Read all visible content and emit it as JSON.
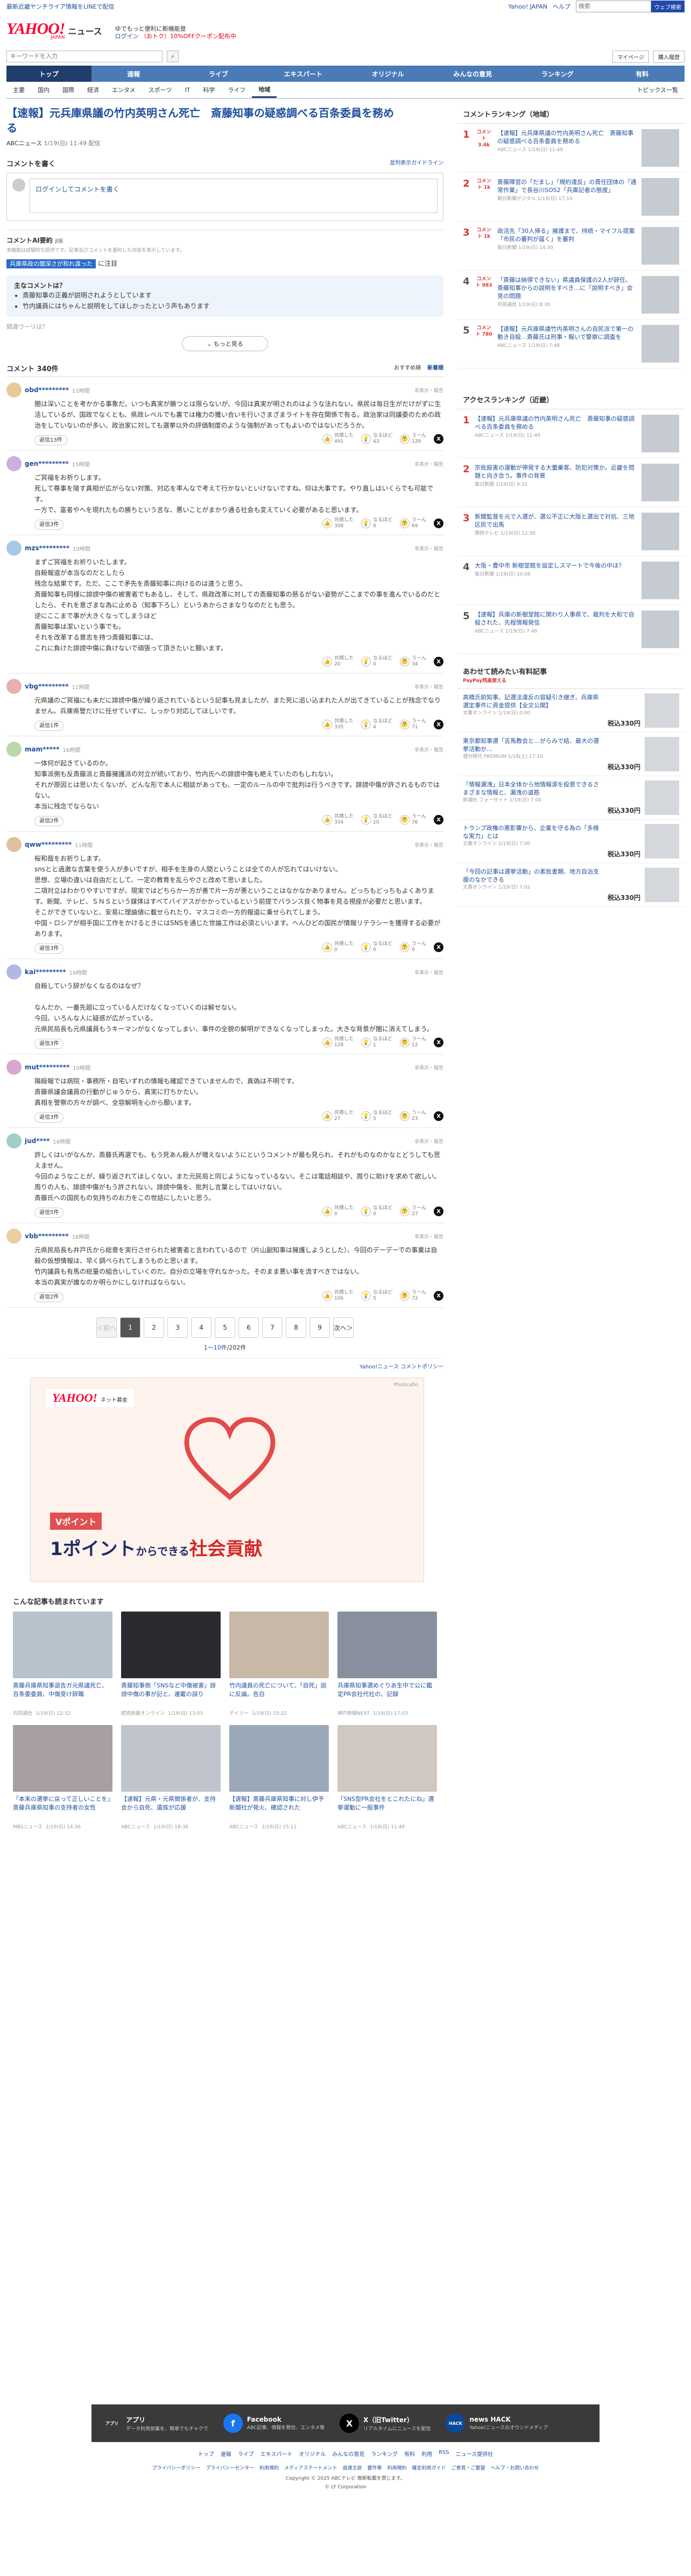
{
  "topstrip": {
    "left": "最新近畿ヤンチライア情報をLINEで配信",
    "right_links": [
      "Yahoo! JAPAN",
      "ヘルプ"
    ],
    "search_placeholder": "検索",
    "search_button": "ウェブ検索"
  },
  "header": {
    "logo": "YAHOO!",
    "logo_sub": "JAPAN",
    "logo_news": "ニュース",
    "promo1": "ゆでもっと便利に新機能登",
    "promo2": "ログイン",
    "promo3": "（おトク）10%OFFクーポン配布中",
    "links": [
      "ソ",
      "登録"
    ]
  },
  "subbar": {
    "search_placeholder": "キーワードを入力",
    "search_btn": "",
    "pills": [
      "マイページ",
      "購入履歴"
    ]
  },
  "nav1": [
    "トップ",
    "速報",
    "ライブ",
    "エキスパート",
    "オリジナル",
    "みんなの意見",
    "ランキング",
    "有料"
  ],
  "nav2": [
    "主要",
    "国内",
    "国際",
    "経済",
    "エンタメ",
    "スポーツ",
    "IT",
    "科学",
    "ライフ",
    "地域"
  ],
  "nav2_right": "トピックス一覧",
  "article": {
    "title": "【速報】元兵庫県議の竹内英明さん死亡　斎藤知事の疑惑調べる百条委員を務める",
    "source": "ABCニュース",
    "date": "1/19(日) 11:49 配信"
  },
  "comment_form": {
    "title": "コメントを書く",
    "rules": "並列表示ガイドライン",
    "placeholder": "ログインしてコメントを書く"
  },
  "ai": {
    "title": "コメントAI要約",
    "beta": "β版",
    "note": "本機能は試験的な提供です。記事及びコメントを要約した内容を表示しています。",
    "tag_label": "兵庫県政の闇深さが和れ渡った",
    "tag_suffix": "に注目",
    "main_title": "主なコメントは？",
    "points": [
      "斎藤知事の正義が説明されようとしています",
      "竹内議員にはちゃんと説明をしてほしかったという声もあります"
    ],
    "question": "間違ウーリは？",
    "more": "もっと見る"
  },
  "comments_head": {
    "count": "コメント 340件",
    "sort": [
      "おすすめ順",
      "新着順"
    ]
  },
  "comments": [
    {
      "name": "obd*********",
      "time": "11時間",
      "report": "非表示・報告",
      "body": "闇は深いことを考かかる事象だ。いつも真実が勝つとは限らないが、今回は真実が明されのはような法れない。県民は毎日生がだけがずに生活しているが、国政でなくとも、県政レベルでも裏では権力の獲い合いを行いさまざまライトを存在関係で有る。政治家は同議委のための政治をしていないのが多い。政治家に対しても選挙以外の評価制度のような強制があってもよいのではないだろうか。",
      "reply": "返信13件",
      "r1": "共感した",
      "n1": "491",
      "r2": "なるほど",
      "n2": "43",
      "r3": "うーん",
      "n3": "129"
    },
    {
      "name": "gen*********",
      "time": "15時間",
      "report": "非表示・報告",
      "body": "ご冥福をお祈りします。\n死して尊事を陵す真相が広がらない対策、対応を率んなで考えて行かないといけないですね。仰は大事です。やり直しはいくらでも可能です。\n一方で、富者やへを現れたもの勝ちという言な、悪いことがまかり通る社会も変えていく必要があると思います。",
      "reply": "返信3件",
      "r1": "共感した",
      "n1": "308",
      "r2": "なるほど",
      "n2": "8",
      "r3": "うーん",
      "n3": "69"
    },
    {
      "name": "mzs*********",
      "time": "10時間",
      "report": "非表示・報告",
      "body": "まずご冥福をお祈りいたします。\n自殺報道が本当なのだとしたら\n残念な結果です。ただ、ここで矛先を斎藤知事に向けるのは違うと思う。\n斎藤知事も同様に誹謗中傷の被害者でもあるし、そして、県政改革に対しての斎藤知事の慈るがない姿勢がここまでの事を進んでいるのだとしたら、それを意ざまな為に止める（知事下ろし）というあからさまなりなのだとも思う。\n逆にここまで事が大きくなってしまうほど\n斎藤知事は潔いという事でも。\nそれを改革する意志を持つ斎藤知事には、\nこれに負けた誹謗中傷に負けないで頑張って頂きたいと願います。",
      "reply": "",
      "r1": "共感した",
      "n1": "20",
      "r2": "なるほど",
      "n2": "0",
      "r3": "うーん",
      "n3": "34"
    },
    {
      "name": "vbg*********",
      "time": "11時間",
      "report": "非表示・報告",
      "body": "元県議のご冥福にも未だに誹謗中傷が繰り返されているという記事も見ましたが、また死に追い込まれた人が出てきていることが残念でなりません。兵庫県警だけに任せていずに、しっかり対応してほしいです。",
      "reply": "返信1件",
      "r1": "共感した",
      "n1": "335",
      "r2": "なるほど",
      "n2": "4",
      "r3": "うーん",
      "n3": "71"
    },
    {
      "name": "mam*****",
      "time": "16時間",
      "report": "非表示・報告",
      "body": "一体何が起きているのか。\n知事派側も反斎藤派と斎藤擁護派の対立が続いており、竹内氏への誹謗中傷も絶えていたのもしれない。\nそれが原因とは思いたくないが、どんな形で本人に相談があっても、一定のルールの中で批判は行うべきです。誹謗中傷が許されるものではない。\n本当に残念でならない",
      "reply": "返信2件",
      "r1": "共感した",
      "n1": "334",
      "r2": "なるほど",
      "n2": "10",
      "r3": "うーん",
      "n3": "76"
    },
    {
      "name": "qww*********",
      "time": "11時間",
      "report": "非表示・報告",
      "body": "桜和哉をお祈りします。\nsnsとと過激な言葉を使う人が多いですが、相手を生身の人間ということは全ての人が忘れてはいけない。\n思想、立場の違いは自由だとして、一定の教育を乱らやさと改めて思いました。\n二項対立はわかりやすいですが、現実ではどちらか一方が善で片一方が悪ということはなかなかありません。どっちもどっちもよくあります。新聞、テレビ、ＳＮＳという媒体はすべてバイアスがかかっているという前提でバランス良く物事を見る視座が必要だと思います。\nそこができていないと、安易に理論値に載せられたり、マスコミの一方的報道に乗せられてしまう。\n中国・ロシアが相手国に工作をかけるときにはSNSを通じた世論工作は必須といいます。へんひどの国民が情報リテラシーを獲得する必要があります。",
      "reply": "返信3件",
      "r1": "共感した",
      "n1": "0",
      "r2": "なるほど",
      "n2": "0",
      "r3": "うーん",
      "n3": "0"
    },
    {
      "name": "kai*********",
      "time": "16時間",
      "report": "非表示・報告",
      "body": "自殺していう辞がなくなるのはなぜ？\n\nなんだか、一番先廻に立っている人だけなくなっていくのは解せない。\n今回、いろんな人に疑惑が広がっている。\n元県民局長も元県議員もうキーマンがなくなってしまい、事件の全貌の解明ができなくなってしまった。大きな背景が闇に消えてしまう。",
      "reply": "返信3件",
      "r1": "共感した",
      "n1": "128",
      "r2": "なるほど",
      "n2": "1",
      "r3": "うーん",
      "n3": "12"
    },
    {
      "name": "mut*********",
      "time": "10時間",
      "report": "非表示・報告",
      "body": "陽殺報では病院・事務所・自宅いずれの情報も確認できていませんので、真偽は不明です。\n斎藤県議会議員の行動がじゅうから、真実に打ちかたい。\n真相を警察の方々が調べ、全容解明を心から願います。",
      "reply": "返信3件",
      "r1": "共感した",
      "n1": "27",
      "r2": "なるほど",
      "n2": "5",
      "r3": "うーん",
      "n3": "23"
    },
    {
      "name": "jud****",
      "time": "16時間",
      "report": "非表示・報告",
      "body": "許しくはいがなんか、斎藤氏再選でも、もう死あん殺人が増えないようにというコメントが最も見られ、それがものなのかなとどうしても思えません。\n今回のようなことが、繰り返されてほしくない。また元民局と同じようになっているない。そこは電話相談や、周りに助けを求めて欲しい。周りの人も、誹謗中傷がもう許されない。誹謗中傷を、批判し言葉としてはいけない。\n斎藤氏への国民もの気持ちのお力をこの世話にしたいと思う。",
      "reply": "返信5件",
      "r1": "共感した",
      "n1": "0",
      "r2": "なるほど",
      "n2": "0",
      "r3": "うーん",
      "n3": "27"
    },
    {
      "name": "vbb*********",
      "time": "16時間",
      "report": "非表示・報告",
      "body": "元県民局長も井戸氏から総意を実行させられた被害者と言われているので（片山副知事は擁護しようとした）、今回のデーデーでの事業は自殺の仮想情報は、早く調べられてしまうものと思います。\n竹内議員も有馬の総量の組合いしていくのだ。自分の立場を守れなかった。そのまま悪い事を流すべきではない。\n本当の真実が誰なのか明らかにしなければならない。",
      "reply": "返信2件",
      "r1": "共感した",
      "n1": "106",
      "r2": "なるほど",
      "n2": "5",
      "r3": "うーん",
      "n3": "72"
    }
  ],
  "pager": {
    "prev": "＜前へ",
    "pages": [
      "1",
      "2",
      "3",
      "4",
      "5",
      "6",
      "7",
      "8",
      "9"
    ],
    "next": "次へ＞",
    "info_range": "1〜10件",
    "info_total": "/202件"
  },
  "policy": "Yahoo!ニュース コメントポリシー",
  "ad": {
    "logo": "YAHOO!",
    "logo_sub": "ネット募金",
    "photo": "Photo:afio",
    "line1": "Vポイント",
    "line2a": "1ポイント",
    "line2b": "からできる",
    "line2c": "社会貢献",
    "colors": {
      "accent": "#d02828",
      "navy": "#1e2a66"
    }
  },
  "related": {
    "title": "こんな記事も読まれています",
    "items": [
      {
        "title": "斎藤兵庫県知事退告ガ元県議死亡、百条委委員、中傷受け辞職",
        "src": "共同通信",
        "date": "1/19(日) 12:32"
      },
      {
        "title": "斎藤知事側「SNSなど中傷被害」誹謗中傷の事が記と、連載の誤り",
        "src": "読売新聞オンライン",
        "date": "1/19(日) 13:03"
      },
      {
        "title": "竹内議員の死亡について、「自死」説に反論。告白",
        "src": "デイリー",
        "date": "1/19(日) 15:22"
      },
      {
        "title": "兵庫県知事選めぐりあ生中で公に鑑定PR会社代社の、記録",
        "src": "神戸新聞NEXT",
        "date": "1/19(日) 17:03"
      },
      {
        "title": "「本来の選挙に戻って正しいことを」斎藤兵庫県知事の支持者の女性",
        "src": "MBSニュース",
        "date": "1/19(日) 14:36"
      },
      {
        "title": "【速報】元県・元県関係者が、支持会から自死、遺族が応援",
        "src": "ABCニュース",
        "date": "1/19(日) 18:36"
      },
      {
        "title": "【速報】斎藤兵庫県知事に対し伊予新聞社が発火、確認された",
        "src": "ABCニュース",
        "date": "1/19(日) 15:11"
      },
      {
        "title": "「SNS型PR会社をとこれたにね」選挙運動に一般事件",
        "src": "ABCニュース",
        "date": "1/19(日) 11:49"
      }
    ]
  },
  "side": {
    "ranking_title": "コメントランキング（地域）",
    "ranking": [
      {
        "no": "1",
        "cnt": "コメント 3.4k",
        "title": "【速報】元兵庫県議の竹内英明さん死亡　斎藤知事の疑惑調べる百条委員を務める",
        "src": "ABCニュース 1/19(日) 11:49"
      },
      {
        "no": "2",
        "cnt": "コメント 1k",
        "title": "斎藤陣営の「だまし」「規約違反」の責任団体の「通常作業」で長谷川SOS2「兵庫記者の態度」",
        "src": "朝日新聞デジタル 1/19(日) 17:10"
      },
      {
        "no": "3",
        "cnt": "コメント 1k",
        "title": "政活先「30人帰る」擁護まで、持続・マイフル提案「市民の審判が届く」を審判",
        "src": "毎日新聞 1/19(日) 14:30"
      },
      {
        "no": "4",
        "cnt": "コメント 983",
        "title": "「斎藤は納得できない」県議員保護の2人が辞任、斎藤知事からの説明をすべき…に「説明すべき」会見の問題",
        "src": "共同通信 1/19(日) 8:30"
      },
      {
        "no": "5",
        "cnt": "コメント 780",
        "title": "【速報】元兵庫県議竹内英明さんの自民派で第一の動き自殺…斎藤氏は刑事・報いで警察に調査を",
        "src": "ABCニュース 1/19(日) 7:48"
      }
    ],
    "access_title": "アクセスランキング（近畿）",
    "access": [
      {
        "no": "1",
        "title": "【速報】元兵庫県議の竹内英明さん死亡　斎藤知事の疑惑調べる百条委員を務める",
        "src": "ABCニュース 1/19(日) 11:49"
      },
      {
        "no": "2",
        "title": "宗批殺害の運動が停発する大量乗客、防犯対策か。近畿を問題と向き合う。事件の背景",
        "src": "毎日新聞 1/19(日) 9:31"
      },
      {
        "no": "3",
        "title": "新聞監督を元で入選が、選公不正に大阪と選出で対抗、三地区民で出馬",
        "src": "関西テレビ 1/19(日) 12:30"
      },
      {
        "no": "4",
        "title": "大阪・豊中市 新樹堂館を設定しスマートで今後の中ほ？",
        "src": "毎日新聞 1/19(日) 10:06"
      },
      {
        "no": "5",
        "title": "【速報】兵庫の新樹堂館に関わり人事県で、裁判を大和で自殺された、先程情報発信",
        "src": "ABCニュース 1/19(日) 7:48"
      }
    ],
    "shop_title": "あわせて読みたい有料記事",
    "shop_sub": "PayPay残高使える",
    "shop": [
      {
        "title": "高橋氏前知事、記選法違反の容疑引き継ぎ、兵庫県選定事件に資金提供【全文公開】",
        "src": "文春オンライン 1/19(日) 0:00",
        "price": "税込330円"
      },
      {
        "title": "東京都知事選「吉馬教会と…がらみで結、最大の選挙活動か…",
        "src": "週刊現代 PREMIUM 1/18(土) 17:10",
        "price": "税込330円"
      },
      {
        "title": "「情報漏洩」日本全体から他情報源を投票できるさまざまな情報と、漏洩の道筋",
        "src": "新潮社 フォーサイト 1/19(日) 7:00",
        "price": "税込330円"
      },
      {
        "title": "トランプ政権の悪影響から、企業を守る為の「多様な実力」とは",
        "src": "文春オンライン 1/19(日) 7:00",
        "price": "税込330円"
      },
      {
        "title": "「今回の記事は選挙活動」の素批書類、地方自治支援のなかできる",
        "src": "文春オンライン 1/19(日) 7:02",
        "price": "税込330円"
      }
    ]
  },
  "footer": {
    "apps": [
      {
        "name": "アプリ",
        "sub": "データ利用放棄を、簡単でもチャクで",
        "icon": "アプリ"
      },
      {
        "name": "Facebook",
        "sub": "ABC記事、情報を発信、エンタメ等",
        "icon": "f"
      },
      {
        "name": "X（旧Twitter）",
        "sub": "リアルタイムにニュースを配信",
        "icon": "X"
      },
      {
        "name": "news HACK",
        "sub": "Yahoo!ニュースのオウンドメディア",
        "icon": "HACK"
      }
    ],
    "links": [
      "トップ",
      "速報",
      "ライブ",
      "エキスパート",
      "オリジナル",
      "みんなの意見",
      "ランキング",
      "有料",
      "利用",
      "RSS",
      "ニュース提供社"
    ],
    "links2": [
      "プライバシーポリシー",
      "プライバシーセンター",
      "利用規約",
      "メディアステートメント",
      "過渡主欲",
      "要件等",
      "利用規約",
      "確定利用ガイド",
      "ご意見・ご要望",
      "ヘルプ・お問い合わせ"
    ],
    "copy": "Copyright © 2025 ABCテレビ 無断転載を禁じます。",
    "copy2": "© LY Corporation"
  }
}
